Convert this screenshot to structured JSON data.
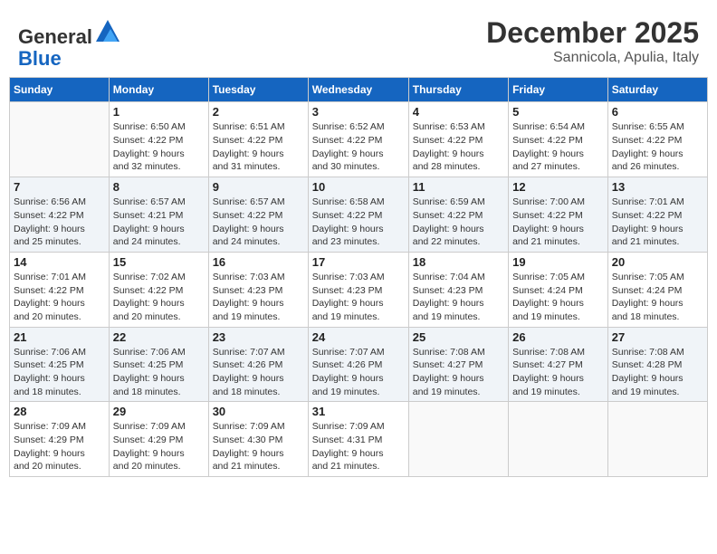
{
  "logo": {
    "general": "General",
    "blue": "Blue"
  },
  "title": "December 2025",
  "location": "Sannicola, Apulia, Italy",
  "days_of_week": [
    "Sunday",
    "Monday",
    "Tuesday",
    "Wednesday",
    "Thursday",
    "Friday",
    "Saturday"
  ],
  "weeks": [
    [
      {
        "day": "",
        "info": ""
      },
      {
        "day": "1",
        "info": "Sunrise: 6:50 AM\nSunset: 4:22 PM\nDaylight: 9 hours\nand 32 minutes."
      },
      {
        "day": "2",
        "info": "Sunrise: 6:51 AM\nSunset: 4:22 PM\nDaylight: 9 hours\nand 31 minutes."
      },
      {
        "day": "3",
        "info": "Sunrise: 6:52 AM\nSunset: 4:22 PM\nDaylight: 9 hours\nand 30 minutes."
      },
      {
        "day": "4",
        "info": "Sunrise: 6:53 AM\nSunset: 4:22 PM\nDaylight: 9 hours\nand 28 minutes."
      },
      {
        "day": "5",
        "info": "Sunrise: 6:54 AM\nSunset: 4:22 PM\nDaylight: 9 hours\nand 27 minutes."
      },
      {
        "day": "6",
        "info": "Sunrise: 6:55 AM\nSunset: 4:22 PM\nDaylight: 9 hours\nand 26 minutes."
      }
    ],
    [
      {
        "day": "7",
        "info": "Sunrise: 6:56 AM\nSunset: 4:22 PM\nDaylight: 9 hours\nand 25 minutes."
      },
      {
        "day": "8",
        "info": "Sunrise: 6:57 AM\nSunset: 4:21 PM\nDaylight: 9 hours\nand 24 minutes."
      },
      {
        "day": "9",
        "info": "Sunrise: 6:57 AM\nSunset: 4:22 PM\nDaylight: 9 hours\nand 24 minutes."
      },
      {
        "day": "10",
        "info": "Sunrise: 6:58 AM\nSunset: 4:22 PM\nDaylight: 9 hours\nand 23 minutes."
      },
      {
        "day": "11",
        "info": "Sunrise: 6:59 AM\nSunset: 4:22 PM\nDaylight: 9 hours\nand 22 minutes."
      },
      {
        "day": "12",
        "info": "Sunrise: 7:00 AM\nSunset: 4:22 PM\nDaylight: 9 hours\nand 21 minutes."
      },
      {
        "day": "13",
        "info": "Sunrise: 7:01 AM\nSunset: 4:22 PM\nDaylight: 9 hours\nand 21 minutes."
      }
    ],
    [
      {
        "day": "14",
        "info": "Sunrise: 7:01 AM\nSunset: 4:22 PM\nDaylight: 9 hours\nand 20 minutes."
      },
      {
        "day": "15",
        "info": "Sunrise: 7:02 AM\nSunset: 4:22 PM\nDaylight: 9 hours\nand 20 minutes."
      },
      {
        "day": "16",
        "info": "Sunrise: 7:03 AM\nSunset: 4:23 PM\nDaylight: 9 hours\nand 19 minutes."
      },
      {
        "day": "17",
        "info": "Sunrise: 7:03 AM\nSunset: 4:23 PM\nDaylight: 9 hours\nand 19 minutes."
      },
      {
        "day": "18",
        "info": "Sunrise: 7:04 AM\nSunset: 4:23 PM\nDaylight: 9 hours\nand 19 minutes."
      },
      {
        "day": "19",
        "info": "Sunrise: 7:05 AM\nSunset: 4:24 PM\nDaylight: 9 hours\nand 19 minutes."
      },
      {
        "day": "20",
        "info": "Sunrise: 7:05 AM\nSunset: 4:24 PM\nDaylight: 9 hours\nand 18 minutes."
      }
    ],
    [
      {
        "day": "21",
        "info": "Sunrise: 7:06 AM\nSunset: 4:25 PM\nDaylight: 9 hours\nand 18 minutes."
      },
      {
        "day": "22",
        "info": "Sunrise: 7:06 AM\nSunset: 4:25 PM\nDaylight: 9 hours\nand 18 minutes."
      },
      {
        "day": "23",
        "info": "Sunrise: 7:07 AM\nSunset: 4:26 PM\nDaylight: 9 hours\nand 18 minutes."
      },
      {
        "day": "24",
        "info": "Sunrise: 7:07 AM\nSunset: 4:26 PM\nDaylight: 9 hours\nand 19 minutes."
      },
      {
        "day": "25",
        "info": "Sunrise: 7:08 AM\nSunset: 4:27 PM\nDaylight: 9 hours\nand 19 minutes."
      },
      {
        "day": "26",
        "info": "Sunrise: 7:08 AM\nSunset: 4:27 PM\nDaylight: 9 hours\nand 19 minutes."
      },
      {
        "day": "27",
        "info": "Sunrise: 7:08 AM\nSunset: 4:28 PM\nDaylight: 9 hours\nand 19 minutes."
      }
    ],
    [
      {
        "day": "28",
        "info": "Sunrise: 7:09 AM\nSunset: 4:29 PM\nDaylight: 9 hours\nand 20 minutes."
      },
      {
        "day": "29",
        "info": "Sunrise: 7:09 AM\nSunset: 4:29 PM\nDaylight: 9 hours\nand 20 minutes."
      },
      {
        "day": "30",
        "info": "Sunrise: 7:09 AM\nSunset: 4:30 PM\nDaylight: 9 hours\nand 21 minutes."
      },
      {
        "day": "31",
        "info": "Sunrise: 7:09 AM\nSunset: 4:31 PM\nDaylight: 9 hours\nand 21 minutes."
      },
      {
        "day": "",
        "info": ""
      },
      {
        "day": "",
        "info": ""
      },
      {
        "day": "",
        "info": ""
      }
    ]
  ]
}
